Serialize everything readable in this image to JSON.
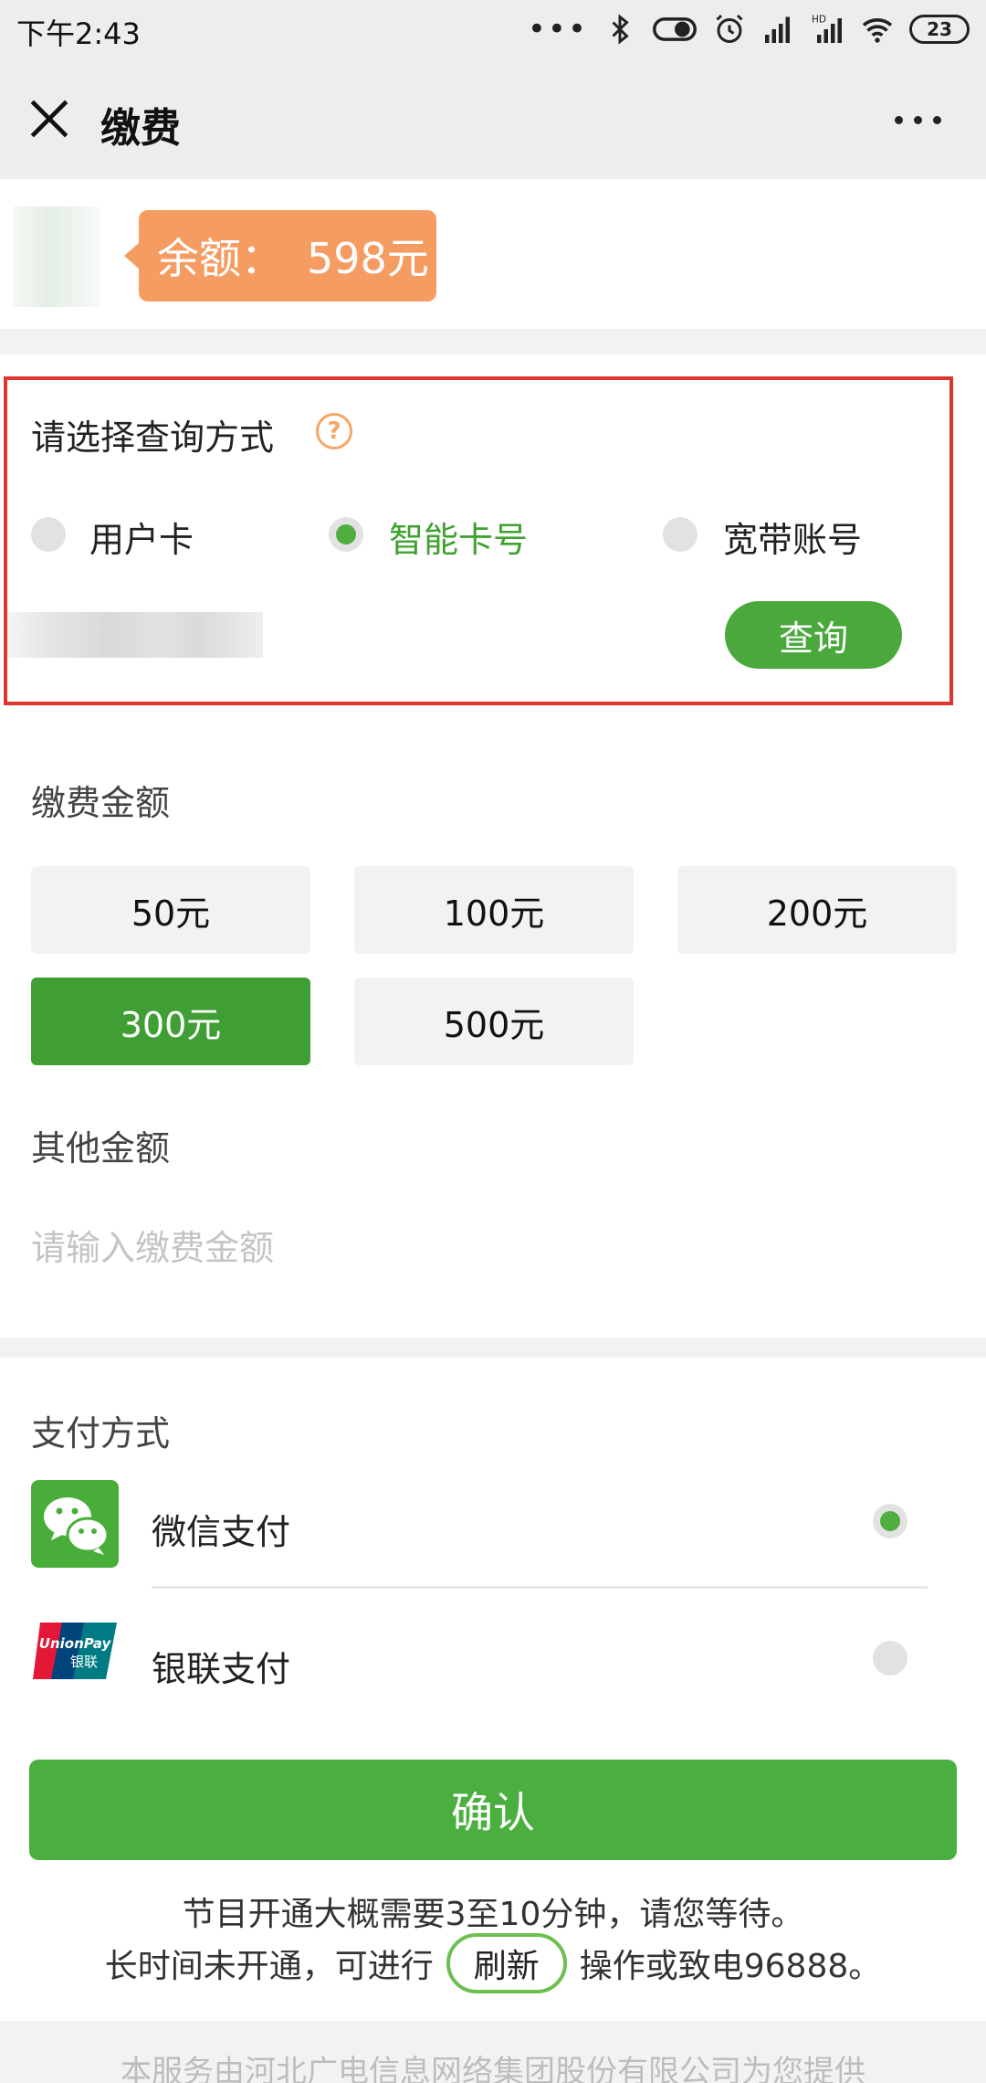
{
  "status_bar": {
    "time": "下午2:43",
    "dots": "•••",
    "battery": "23"
  },
  "header": {
    "title": "缴费"
  },
  "balance": {
    "label": "余额：",
    "value": "598元"
  },
  "query": {
    "title": "请选择查询方式",
    "help": "?",
    "options": [
      {
        "label": "用户卡",
        "selected": false
      },
      {
        "label": "智能卡号",
        "selected": true
      },
      {
        "label": "宽带账号",
        "selected": false
      }
    ],
    "button": "查询"
  },
  "amount": {
    "title": "缴费金额",
    "options": [
      "50元",
      "100元",
      "200元",
      "300元",
      "500元"
    ],
    "selected": "300元",
    "other_title": "其他金额",
    "other_placeholder": "请输入缴费金额"
  },
  "payment": {
    "title": "支付方式",
    "methods": [
      {
        "label": "微信支付",
        "selected": true
      },
      {
        "label": "银联支付",
        "selected": false
      }
    ],
    "unionpay_logo_text": "UnionPay 银联"
  },
  "confirm": "确认",
  "notice": {
    "line1": "节目开通大概需要3至10分钟，请您等待。",
    "line2_before": "长时间未开通，可进行",
    "refresh": "刷新",
    "line2_after": "操作或致电96888。"
  },
  "footer": "本服务由河北广电信息网络集团股份有限公司为您提供",
  "colors": {
    "green": "#4aaf3e",
    "orange": "#f59c62",
    "red_box": "#e0352f"
  }
}
